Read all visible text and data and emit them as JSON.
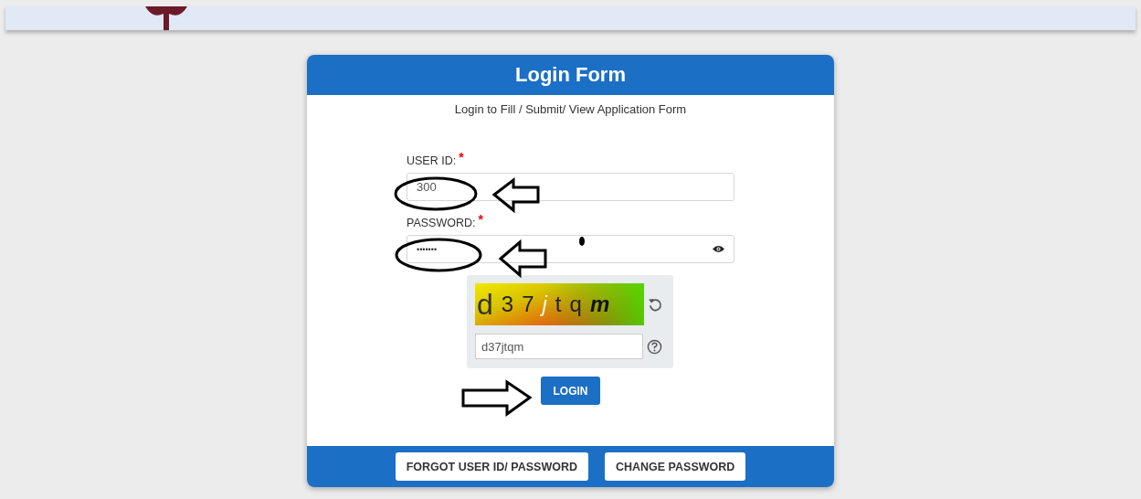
{
  "login_form": {
    "title": "Login Form",
    "subtitle": "Login to Fill / Submit/ View Application Form",
    "fields": [
      {
        "kind": "text",
        "label": "USER ID:",
        "required_mark": "*",
        "value": "300"
      },
      {
        "kind": "password",
        "label": "PASSWORD:",
        "required_mark": "*",
        "value": "•••••••"
      }
    ],
    "captcha": {
      "characters": [
        {
          "char": "d",
          "kind": "large"
        },
        {
          "char": "3",
          "kind": "plain"
        },
        {
          "char": "7",
          "kind": "plain"
        },
        {
          "char": "j",
          "kind": "light-italic"
        },
        {
          "char": "t",
          "kind": "plain"
        },
        {
          "char": "q",
          "kind": "plain"
        },
        {
          "char": "m",
          "kind": "bold-italic"
        }
      ],
      "value": "d37jtqm"
    },
    "submit": "LOGIN",
    "footer_buttons": [
      "FORGOT USER ID/ PASSWORD",
      "CHANGE PASSWORD"
    ]
  }
}
